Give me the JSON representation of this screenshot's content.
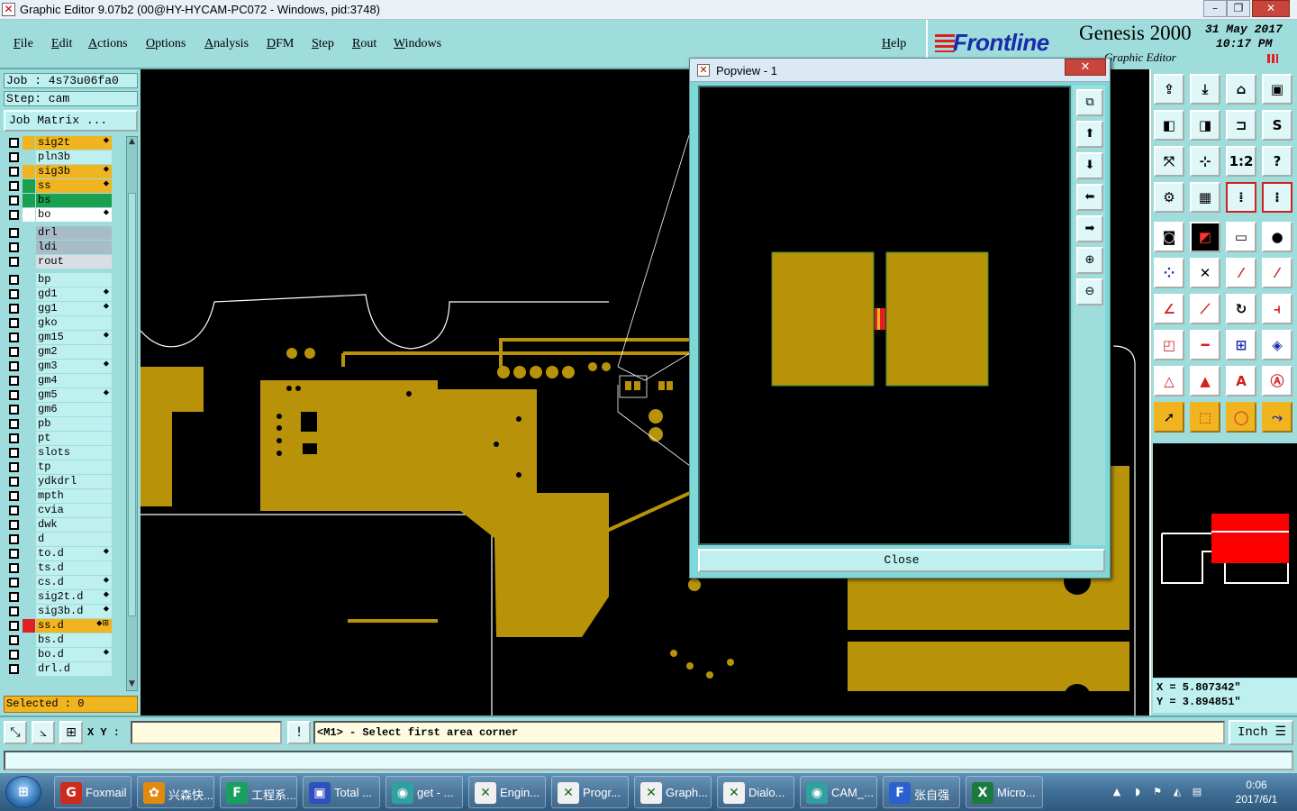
{
  "window": {
    "title": "Graphic Editor 9.07b2 (00@HY-HYCAM-PC072 - Windows, pid:3748)",
    "controls": [
      "–",
      "❐",
      "✕"
    ]
  },
  "menu": {
    "items": [
      "File",
      "Edit",
      "Actions",
      "Options",
      "Analysis",
      "DFM",
      "Step",
      "Rout",
      "Windows"
    ],
    "help": "Help"
  },
  "brand": {
    "logo": "Frontline",
    "product": "Genesis 2000",
    "date": "31 May 2017",
    "time": "10:17 PM",
    "subtitle": "Graphic Editor"
  },
  "job": {
    "job_line": "Job : 4s73u06fa0",
    "step_line": "Step: cam",
    "matrix_button": "Job Matrix ..."
  },
  "layers": [
    {
      "name": "sig2t",
      "color": "#f0b420",
      "bg": "#f0b420",
      "mark": "⬥"
    },
    {
      "name": "pln3b",
      "color": "#9fdcdc",
      "bg": "#bff0f0",
      "mark": ""
    },
    {
      "name": "sig3b",
      "color": "#f0b420",
      "bg": "#f0b420",
      "mark": "⬥"
    },
    {
      "name": "ss",
      "color": "#1aa050",
      "bg": "#f0b420",
      "mark": "⬥"
    },
    {
      "name": "bs",
      "color": "#1aa050",
      "bg": "#1aa050",
      "mark": ""
    },
    {
      "name": "bo",
      "color": "#ffffff",
      "bg": "#ffffff",
      "mark": "⬥"
    },
    {
      "name": "drl",
      "color": "#9fdcdc",
      "bg": "#a8bcc8",
      "mark": ""
    },
    {
      "name": "ldi",
      "color": "#9fdcdc",
      "bg": "#a8bcc8",
      "mark": ""
    },
    {
      "name": "rout",
      "color": "#9fdcdc",
      "bg": "#d8dfe4",
      "mark": ""
    },
    {
      "name": "bp",
      "color": "#9fdcdc",
      "bg": "#bff0f0",
      "mark": ""
    },
    {
      "name": "gd1",
      "color": "#9fdcdc",
      "bg": "#bff0f0",
      "mark": "⬥"
    },
    {
      "name": "gg1",
      "color": "#9fdcdc",
      "bg": "#bff0f0",
      "mark": "⬥"
    },
    {
      "name": "gko",
      "color": "#9fdcdc",
      "bg": "#bff0f0",
      "mark": ""
    },
    {
      "name": "gm15",
      "color": "#9fdcdc",
      "bg": "#bff0f0",
      "mark": "⬥"
    },
    {
      "name": "gm2",
      "color": "#9fdcdc",
      "bg": "#bff0f0",
      "mark": ""
    },
    {
      "name": "gm3",
      "color": "#9fdcdc",
      "bg": "#bff0f0",
      "mark": "⬥"
    },
    {
      "name": "gm4",
      "color": "#9fdcdc",
      "bg": "#bff0f0",
      "mark": ""
    },
    {
      "name": "gm5",
      "color": "#9fdcdc",
      "bg": "#bff0f0",
      "mark": "⬥"
    },
    {
      "name": "gm6",
      "color": "#9fdcdc",
      "bg": "#bff0f0",
      "mark": ""
    },
    {
      "name": "pb",
      "color": "#9fdcdc",
      "bg": "#bff0f0",
      "mark": ""
    },
    {
      "name": "pt",
      "color": "#9fdcdc",
      "bg": "#bff0f0",
      "mark": ""
    },
    {
      "name": "slots",
      "color": "#9fdcdc",
      "bg": "#bff0f0",
      "mark": ""
    },
    {
      "name": "tp",
      "color": "#9fdcdc",
      "bg": "#bff0f0",
      "mark": ""
    },
    {
      "name": "ydkdrl",
      "color": "#9fdcdc",
      "bg": "#bff0f0",
      "mark": ""
    },
    {
      "name": "mpth",
      "color": "#9fdcdc",
      "bg": "#bff0f0",
      "mark": ""
    },
    {
      "name": "cvia",
      "color": "#9fdcdc",
      "bg": "#bff0f0",
      "mark": ""
    },
    {
      "name": "dwk",
      "color": "#9fdcdc",
      "bg": "#bff0f0",
      "mark": ""
    },
    {
      "name": "d",
      "color": "#9fdcdc",
      "bg": "#bff0f0",
      "mark": ""
    },
    {
      "name": "to.d",
      "color": "#9fdcdc",
      "bg": "#bff0f0",
      "mark": "⬥"
    },
    {
      "name": "ts.d",
      "color": "#9fdcdc",
      "bg": "#bff0f0",
      "mark": ""
    },
    {
      "name": "cs.d",
      "color": "#9fdcdc",
      "bg": "#bff0f0",
      "mark": "⬥"
    },
    {
      "name": "sig2t.d",
      "color": "#9fdcdc",
      "bg": "#bff0f0",
      "mark": "⬥"
    },
    {
      "name": "sig3b.d",
      "color": "#9fdcdc",
      "bg": "#bff0f0",
      "mark": "⬥"
    },
    {
      "name": "ss.d",
      "color": "#e02020",
      "bg": "#f0b420",
      "mark": "⬥⊞"
    },
    {
      "name": "bs.d",
      "color": "#9fdcdc",
      "bg": "#bff0f0",
      "mark": ""
    },
    {
      "name": "bo.d",
      "color": "#9fdcdc",
      "bg": "#bff0f0",
      "mark": "⬥"
    },
    {
      "name": "drl.d",
      "color": "#9fdcdc",
      "bg": "#bff0f0",
      "mark": ""
    }
  ],
  "selected": "Selected : 0",
  "coords": {
    "x_line": "X = 5.807342\"",
    "y_line": "Y = 3.894851\""
  },
  "statusbar": {
    "xy_label": "X Y :",
    "xy_value": "",
    "message": "<M1> - Select first area corner",
    "units": "Inch"
  },
  "popview": {
    "title": "Popview - 1",
    "close_label": "Close"
  },
  "taskbar": {
    "tasks": [
      {
        "label": "Foxmail",
        "icon": "G",
        "color": "#d02a1c"
      },
      {
        "label": "兴森快...",
        "icon": "✿",
        "color": "#e08a10"
      },
      {
        "label": "工程系...",
        "icon": "F",
        "color": "#18a060"
      },
      {
        "label": "Total ...",
        "icon": "▣",
        "color": "#3050c0"
      },
      {
        "label": "get - ...",
        "icon": "◉",
        "color": "#30a0a0"
      },
      {
        "label": "Engin...",
        "icon": "✕",
        "color": "#f0f0f0"
      },
      {
        "label": "Progr...",
        "icon": "✕",
        "color": "#f0f0f0"
      },
      {
        "label": "Graph...",
        "icon": "✕",
        "color": "#f0f0f0"
      },
      {
        "label": "Dialo...",
        "icon": "✕",
        "color": "#f0f0f0"
      },
      {
        "label": "CAM_...",
        "icon": "◉",
        "color": "#30a0a0"
      },
      {
        "label": "张自强",
        "icon": "F",
        "color": "#2a60d0"
      },
      {
        "label": "Micro...",
        "icon": "X",
        "color": "#1d7a3e"
      }
    ],
    "clock_time": "0:06",
    "clock_date": "2017/6/1"
  }
}
